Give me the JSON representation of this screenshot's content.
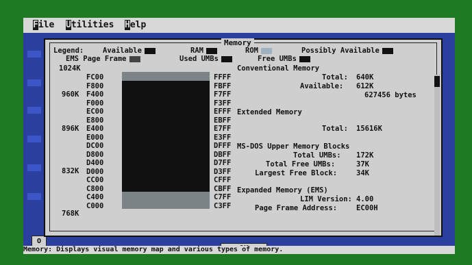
{
  "menubar": {
    "items": [
      {
        "hotkey": "F",
        "rest": "ile"
      },
      {
        "hotkey": "U",
        "rest": "tilities"
      },
      {
        "hotkey": "H",
        "rest": "elp"
      }
    ]
  },
  "dialog": {
    "title": "Memory",
    "legend": {
      "label": "Legend:",
      "available": "Available",
      "ram": "RAM",
      "rom": "ROM",
      "possibly_available": "Possibly Available",
      "ems_page_frame": "EMS Page Frame",
      "used_umbs": "Used UMBs",
      "free_umbs": "Free UMBs"
    },
    "kb_labels": [
      "1024K",
      "960K",
      "896K",
      "832K",
      "768K"
    ],
    "seg_left": [
      "FC00",
      "F800",
      "F400",
      "F000",
      "EC00",
      "E800",
      "E400",
      "E000",
      "DC00",
      "D800",
      "D400",
      "D000",
      "CC00",
      "C800",
      "C400",
      "C000"
    ],
    "seg_right": [
      "FFFF",
      "FBFF",
      "F7FF",
      "F3FF",
      "EFFF",
      "EBFF",
      "E7FF",
      "E3FF",
      "DFFF",
      "DBFF",
      "D7FF",
      "D3FF",
      "CFFF",
      "CBFF",
      "C7FF",
      "C3FF"
    ],
    "map_rows": [
      "gray",
      "dark",
      "dark",
      "dark",
      "dark",
      "dark",
      "dark",
      "dark",
      "dark",
      "dark",
      "dark",
      "dark",
      "dark",
      "dark",
      "gray",
      "gray"
    ],
    "info": {
      "conventional_heading": "Conventional Memory",
      "total_label": "Total:",
      "total_value": "640K",
      "available_label": "Available:",
      "available_value": "612K",
      "bytes_value": "627456 bytes",
      "extended_heading": "Extended Memory",
      "ext_total_label": "Total:",
      "ext_total_value": "15616K",
      "umb_heading": "MS-DOS Upper Memory Blocks",
      "total_umbs_label": "Total UMBs:",
      "total_umbs_value": "172K",
      "total_free_umbs_label": "Total Free UMBs:",
      "total_free_umbs_value": "37K",
      "largest_free_label": "Largest Free Block:",
      "largest_free_value": "34K",
      "ems_heading": "Expanded Memory (EMS)",
      "lim_label": "LIM Version:",
      "lim_value": "4.00",
      "page_frame_label": "Page Frame Address:",
      "page_frame_value": "EC00H"
    },
    "ok_label": "OK"
  },
  "left_button_label": "O",
  "status": {
    "text": "Memory: Displays visual memory map and various types of memory."
  }
}
